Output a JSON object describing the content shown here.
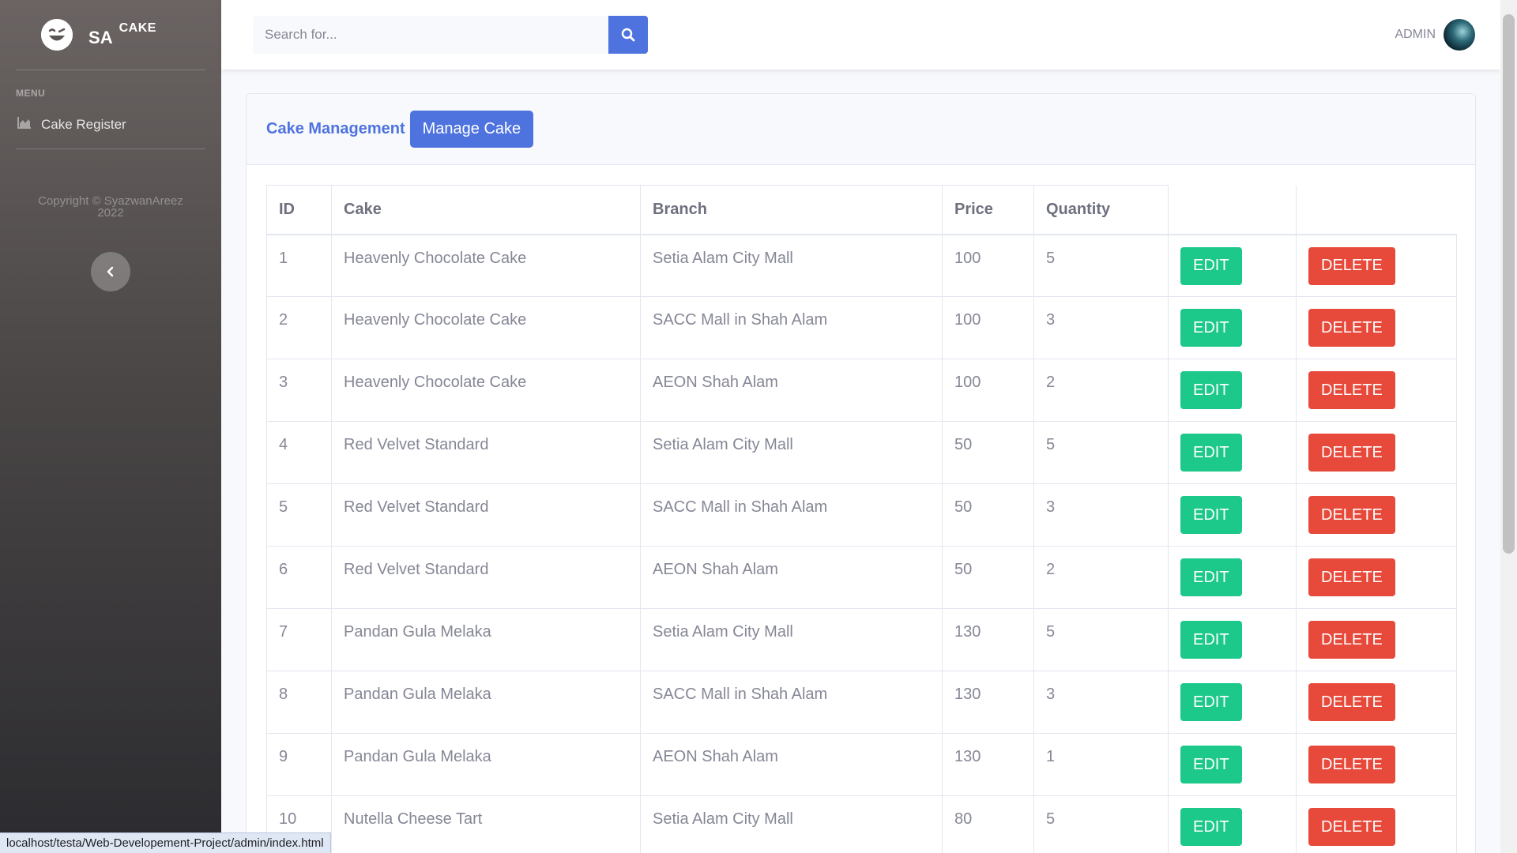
{
  "sidebar": {
    "brand_main": "SA",
    "brand_sub": "CAKE",
    "menu_heading": "MENU",
    "items": [
      {
        "label": "Cake Register",
        "icon": "chart-area-icon"
      }
    ],
    "copyright_line1": "Copyright © SyazwanAreez",
    "copyright_line2": "2022"
  },
  "topbar": {
    "search_placeholder": "Search for...",
    "user_name": "ADMIN"
  },
  "card": {
    "title": "Cake Management",
    "manage_button": "Manage Cake"
  },
  "table": {
    "headers": [
      "ID",
      "Cake",
      "Branch",
      "Price",
      "Quantity"
    ],
    "edit_label": "EDIT",
    "delete_label": "DELETE",
    "rows": [
      {
        "id": "1",
        "cake": "Heavenly Chocolate Cake",
        "branch": "Setia Alam City Mall",
        "price": "100",
        "quantity": "5"
      },
      {
        "id": "2",
        "cake": "Heavenly Chocolate Cake",
        "branch": "SACC Mall in Shah Alam",
        "price": "100",
        "quantity": "3"
      },
      {
        "id": "3",
        "cake": "Heavenly Chocolate Cake",
        "branch": "AEON Shah Alam",
        "price": "100",
        "quantity": "2"
      },
      {
        "id": "4",
        "cake": "Red Velvet Standard",
        "branch": "Setia Alam City Mall",
        "price": "50",
        "quantity": "5"
      },
      {
        "id": "5",
        "cake": "Red Velvet Standard",
        "branch": "SACC Mall in Shah Alam",
        "price": "50",
        "quantity": "3"
      },
      {
        "id": "6",
        "cake": "Red Velvet Standard",
        "branch": "AEON Shah Alam",
        "price": "50",
        "quantity": "2"
      },
      {
        "id": "7",
        "cake": "Pandan Gula Melaka",
        "branch": "Setia Alam City Mall",
        "price": "130",
        "quantity": "5"
      },
      {
        "id": "8",
        "cake": "Pandan Gula Melaka",
        "branch": "SACC Mall in Shah Alam",
        "price": "130",
        "quantity": "3"
      },
      {
        "id": "9",
        "cake": "Pandan Gula Melaka",
        "branch": "AEON Shah Alam",
        "price": "130",
        "quantity": "1"
      },
      {
        "id": "10",
        "cake": "Nutella Cheese Tart",
        "branch": "Setia Alam City Mall",
        "price": "80",
        "quantity": "5"
      }
    ]
  },
  "statusbar": {
    "url": "localhost/testa/Web-Developement-Project/admin/index.html"
  },
  "colors": {
    "primary": "#4e73df",
    "success": "#1cc88a",
    "danger": "#e74a3b"
  }
}
